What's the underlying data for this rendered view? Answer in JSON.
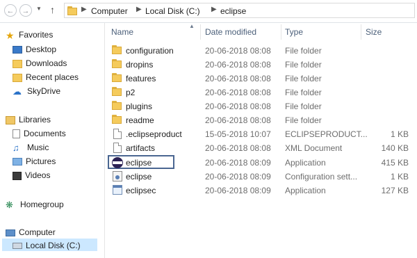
{
  "address_bar": {
    "crumbs": [
      "Computer",
      "Local Disk (C:)",
      "eclipse"
    ]
  },
  "nav": {
    "favorites": {
      "label": "Favorites",
      "items": [
        "Desktop",
        "Downloads",
        "Recent places",
        "SkyDrive"
      ]
    },
    "libraries": {
      "label": "Libraries",
      "items": [
        "Documents",
        "Music",
        "Pictures",
        "Videos"
      ]
    },
    "homegroup": {
      "label": "Homegroup"
    },
    "computer": {
      "label": "Computer",
      "items": [
        "Local Disk (C:)"
      ]
    }
  },
  "columns": {
    "name": "Name",
    "date": "Date modified",
    "type": "Type",
    "size": "Size"
  },
  "files": [
    {
      "name": "configuration",
      "date": "20-06-2018 08:08",
      "type": "File folder",
      "size": "",
      "icon": "folder-icon"
    },
    {
      "name": "dropins",
      "date": "20-06-2018 08:08",
      "type": "File folder",
      "size": "",
      "icon": "folder-icon"
    },
    {
      "name": "features",
      "date": "20-06-2018 08:08",
      "type": "File folder",
      "size": "",
      "icon": "folder-icon"
    },
    {
      "name": "p2",
      "date": "20-06-2018 08:08",
      "type": "File folder",
      "size": "",
      "icon": "folder-icon"
    },
    {
      "name": "plugins",
      "date": "20-06-2018 08:08",
      "type": "File folder",
      "size": "",
      "icon": "folder-icon"
    },
    {
      "name": "readme",
      "date": "20-06-2018 08:08",
      "type": "File folder",
      "size": "",
      "icon": "folder-icon"
    },
    {
      "name": ".eclipseproduct",
      "date": "15-05-2018 10:07",
      "type": "ECLIPSEPRODUCT...",
      "size": "1 KB",
      "icon": "document-icon"
    },
    {
      "name": "artifacts",
      "date": "20-06-2018 08:08",
      "type": "XML Document",
      "size": "140 KB",
      "icon": "document-icon"
    },
    {
      "name": "eclipse",
      "date": "20-06-2018 08:09",
      "type": "Application",
      "size": "415 KB",
      "icon": "eclipse-icon"
    },
    {
      "name": "eclipse",
      "date": "20-06-2018 08:09",
      "type": "Configuration sett...",
      "size": "1 KB",
      "icon": "config-icon"
    },
    {
      "name": "eclipsec",
      "date": "20-06-2018 08:09",
      "type": "Application",
      "size": "127 KB",
      "icon": "application-icon"
    }
  ],
  "colors": {
    "highlight_border": "#4a6691",
    "selected_bg": "#cce8ff",
    "header_text": "#4c607a"
  }
}
